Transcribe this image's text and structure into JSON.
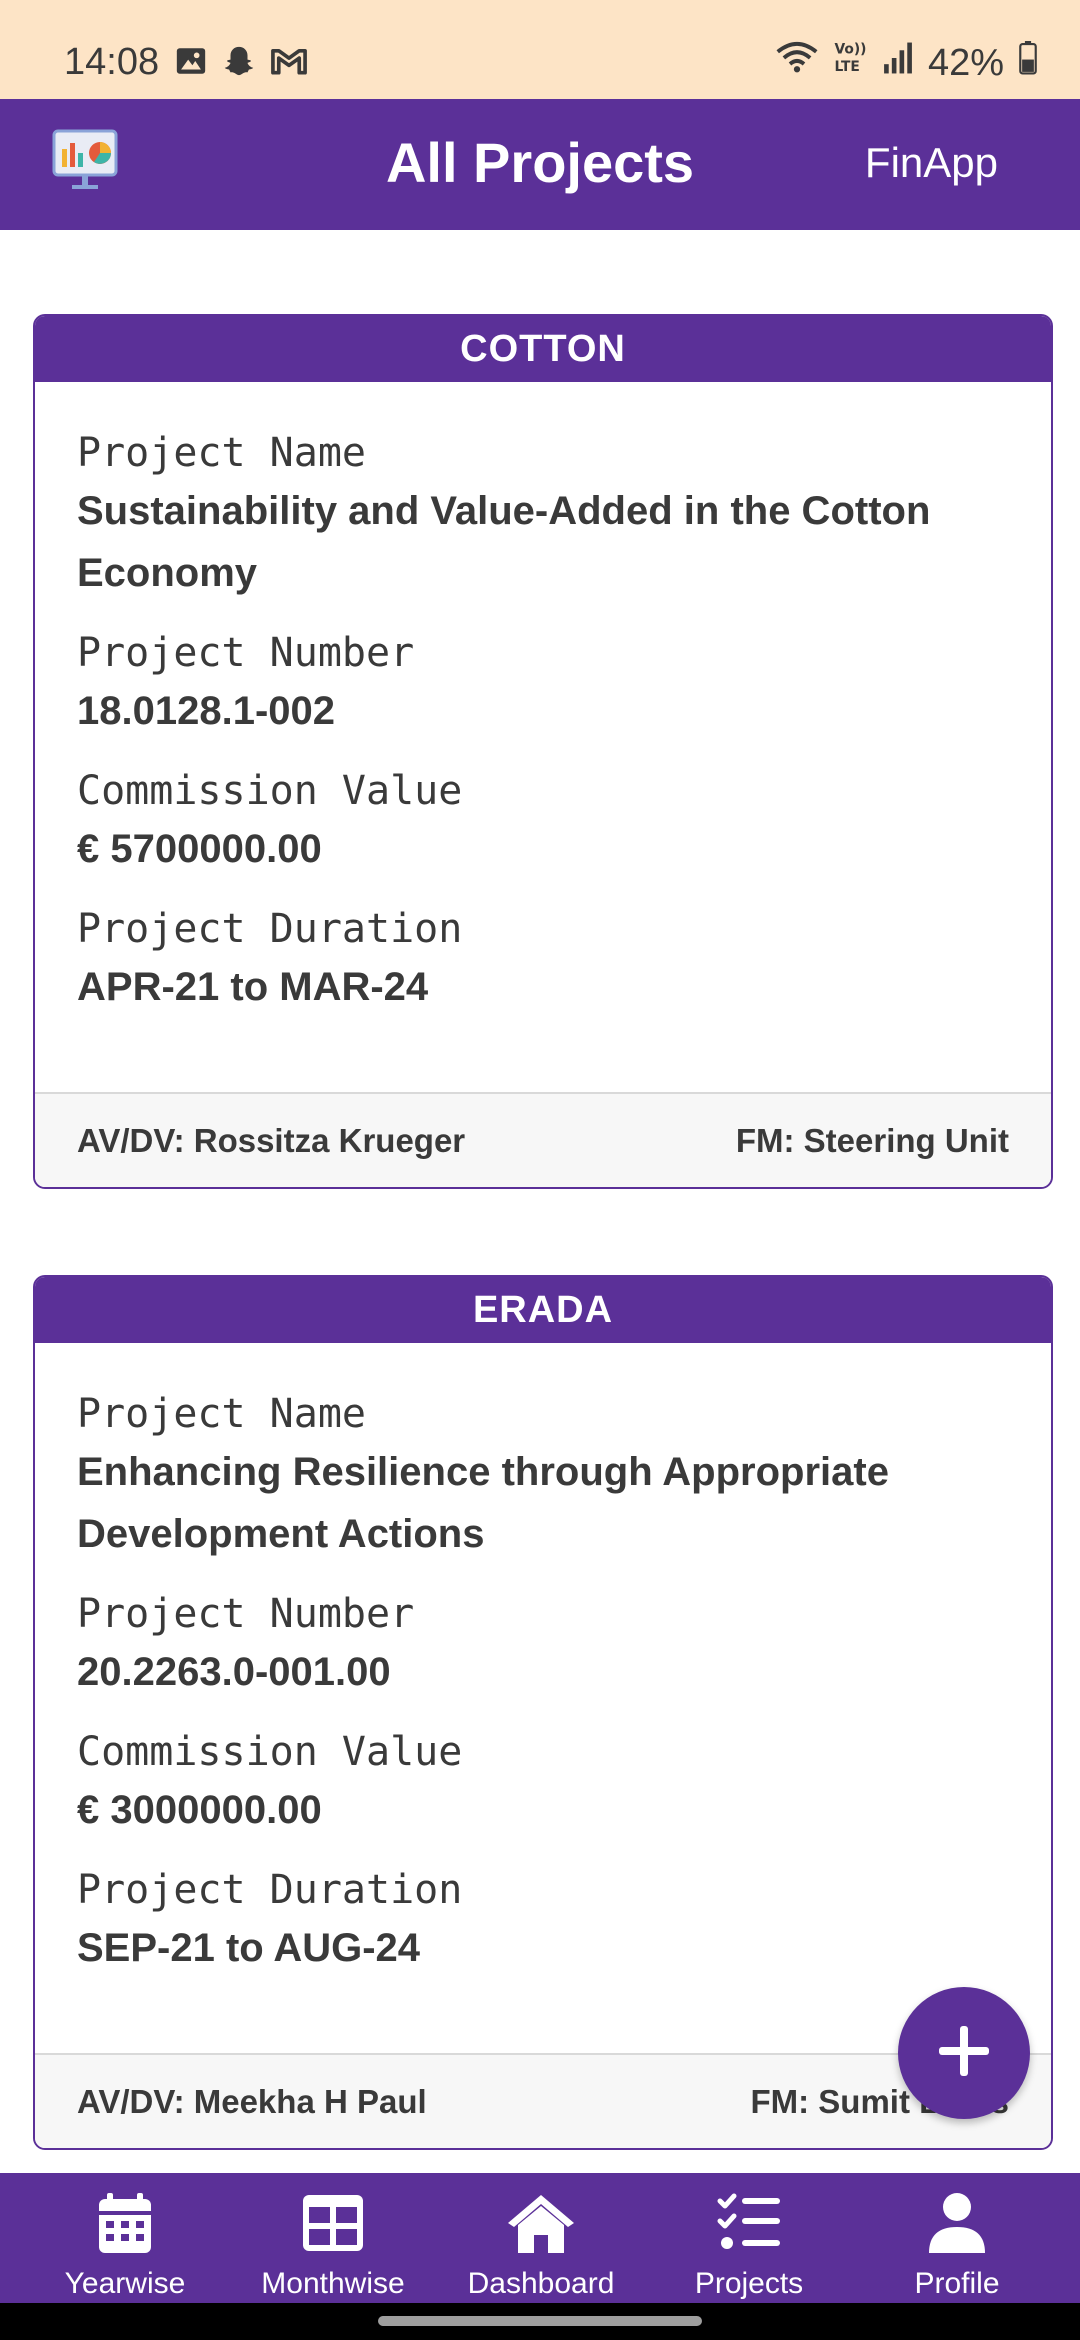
{
  "status_bar": {
    "time": "14:08",
    "battery": "42%",
    "left_icons": [
      "gallery-icon",
      "snapchat-icon",
      "gmail-icon"
    ],
    "right_icons": [
      "wifi-icon",
      "volte-icon",
      "signal-icon",
      "battery-icon"
    ]
  },
  "app_bar": {
    "title": "All Projects",
    "brand": "FinApp",
    "logo_icon": "presentation-chart-icon"
  },
  "projects": [
    {
      "code": "COTTON",
      "name_label": "Project Name",
      "name": "Sustainability and Value-Added in the Cotton Economy",
      "number_label": "Project Number",
      "number": "18.0128.1-002",
      "value_label": "Commission Value",
      "value": "€ 5700000.00",
      "duration_label": "Project Duration",
      "duration": "APR-21 to MAR-24",
      "avdv": "AV/DV: Rossitza Krueger",
      "fm": "FM: Steering Unit"
    },
    {
      "code": "ERADA",
      "name_label": "Project Name",
      "name": "Enhancing Resilience through Appropriate Development Actions",
      "number_label": "Project Number",
      "number": "20.2263.0-001.00",
      "value_label": "Commission Value",
      "value": "€ 3000000.00",
      "duration_label": "Project Duration",
      "duration": "SEP-21 to AUG-24",
      "avdv": "AV/DV: Meekha H Paul",
      "fm": "FM: Sumit Bains"
    }
  ],
  "fab": {
    "icon": "plus-icon"
  },
  "bottom_nav": {
    "items": [
      {
        "label": "Yearwise",
        "icon": "calendar-icon"
      },
      {
        "label": "Monthwise",
        "icon": "grid-icon"
      },
      {
        "label": "Dashboard",
        "icon": "home-icon"
      },
      {
        "label": "Projects",
        "icon": "checklist-icon"
      },
      {
        "label": "Profile",
        "icon": "user-icon"
      }
    ]
  },
  "colors": {
    "primary": "#5b3098",
    "status_bar_bg": "#fde4c6",
    "text": "#3a3a3a",
    "footer_bg": "#f7f7f7"
  }
}
